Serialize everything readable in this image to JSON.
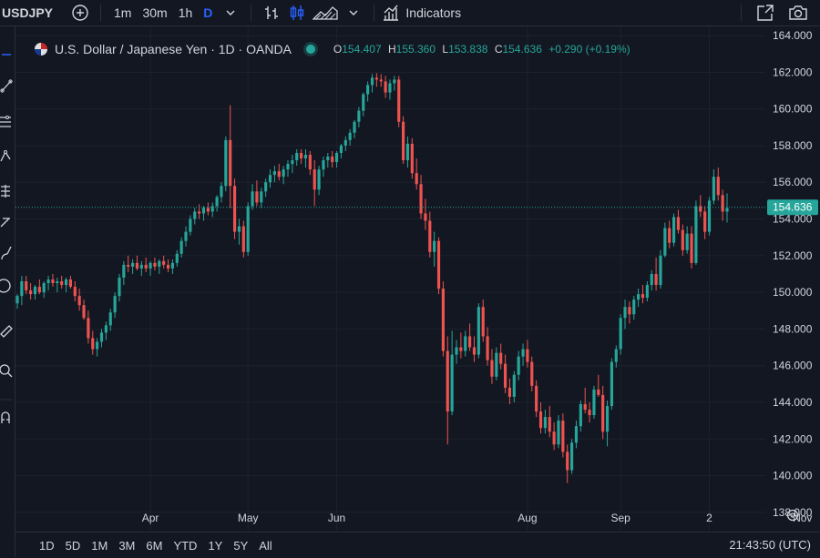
{
  "toolbar": {
    "symbol": "USDJPY",
    "intervals": [
      "1m",
      "30m",
      "1h",
      "D"
    ],
    "indicators_label": "Indicators"
  },
  "legend": {
    "title": "U.S. Dollar / Japanese Yen · 1D · OANDA",
    "open_label": "O",
    "open": "154.407",
    "high_label": "H",
    "high": "155.360",
    "low_label": "L",
    "low": "153.838",
    "close_label": "C",
    "close": "154.636",
    "change": "+0.290 (+0.19%)"
  },
  "ranges": [
    "1D",
    "5D",
    "1M",
    "3M",
    "6M",
    "YTD",
    "1Y",
    "5Y",
    "All"
  ],
  "clock": "21:43:50 (UTC)",
  "colors": {
    "background": "#131722",
    "up": "#26a69a",
    "down": "#ef5350",
    "grid": "#1e222d",
    "text": "#d1d4dc"
  },
  "icons": {
    "toolbar": [
      "add-symbol-icon",
      "chevron-down-icon",
      "bar-chart-icon",
      "candles-icon",
      "area-chart-icon",
      "indicators-icon",
      "fullscreen-icon",
      "camera-icon"
    ],
    "leftbar": [
      "crosshair-icon",
      "trendline-icon",
      "fib-icon",
      "pattern-icon",
      "forecast-icon",
      "projection-icon",
      "brush-icon",
      "text-icon",
      "emoji-icon",
      "ruler-icon",
      "zoom-icon",
      "magnet-icon"
    ]
  },
  "chart_data": {
    "type": "candlestick",
    "title": "U.S. Dollar / Japanese Yen · 1D · OANDA",
    "y_ticks": [
      "164.000",
      "162.000",
      "160.000",
      "158.000",
      "156.000",
      "154.000",
      "152.000",
      "150.000",
      "148.000",
      "146.000",
      "144.000",
      "142.000",
      "140.000",
      "138.000"
    ],
    "ylim": [
      137,
      164.5
    ],
    "x_ticks": [
      "Apr",
      "May",
      "Jun",
      "Aug",
      "Sep",
      "2",
      "Nov"
    ],
    "current_price": "154.636",
    "grid": true,
    "series": [
      {
        "name": "USDJPY",
        "ohlc": [
          [
            149.4,
            149.9,
            149.1,
            149.8
          ],
          [
            149.8,
            150.9,
            149.3,
            150.6
          ],
          [
            150.6,
            150.9,
            149.9,
            150.1
          ],
          [
            150.1,
            150.5,
            149.6,
            149.9
          ],
          [
            149.9,
            150.4,
            149.6,
            150.3
          ],
          [
            150.3,
            150.7,
            149.9,
            150.0
          ],
          [
            150.0,
            150.6,
            149.7,
            150.5
          ],
          [
            150.5,
            150.9,
            150.1,
            150.7
          ],
          [
            150.7,
            151.0,
            150.3,
            150.5
          ],
          [
            150.5,
            150.8,
            150.0,
            150.6
          ],
          [
            150.6,
            150.9,
            150.2,
            150.4
          ],
          [
            150.4,
            150.8,
            150.0,
            150.7
          ],
          [
            150.7,
            150.9,
            150.2,
            150.3
          ],
          [
            150.3,
            150.6,
            149.5,
            149.8
          ],
          [
            149.8,
            150.2,
            149.0,
            149.3
          ],
          [
            149.3,
            149.6,
            148.5,
            148.6
          ],
          [
            148.6,
            149.0,
            147.2,
            147.5
          ],
          [
            147.5,
            147.9,
            146.6,
            146.9
          ],
          [
            146.9,
            147.5,
            146.5,
            147.3
          ],
          [
            147.3,
            148.0,
            147.0,
            147.8
          ],
          [
            147.8,
            148.4,
            147.4,
            148.2
          ],
          [
            148.2,
            149.1,
            147.9,
            148.9
          ],
          [
            148.9,
            150.0,
            148.6,
            149.8
          ],
          [
            149.8,
            151.0,
            149.5,
            150.8
          ],
          [
            150.8,
            151.7,
            150.4,
            151.5
          ],
          [
            151.5,
            152.0,
            151.1,
            151.4
          ],
          [
            151.4,
            151.8,
            151.0,
            151.6
          ],
          [
            151.6,
            152.0,
            151.2,
            151.3
          ],
          [
            151.3,
            151.7,
            150.9,
            151.5
          ],
          [
            151.5,
            151.9,
            151.1,
            151.3
          ],
          [
            151.3,
            151.7,
            150.9,
            151.6
          ],
          [
            151.6,
            151.9,
            151.2,
            151.4
          ],
          [
            151.4,
            151.8,
            151.0,
            151.7
          ],
          [
            151.7,
            152.0,
            151.3,
            151.5
          ],
          [
            151.5,
            151.8,
            151.1,
            151.3
          ],
          [
            151.3,
            151.8,
            151.0,
            151.6
          ],
          [
            151.6,
            152.3,
            151.4,
            152.1
          ],
          [
            152.1,
            153.0,
            151.9,
            152.8
          ],
          [
            152.8,
            153.6,
            152.5,
            153.3
          ],
          [
            153.3,
            154.2,
            153.1,
            154.0
          ],
          [
            154.0,
            154.6,
            153.7,
            154.4
          ],
          [
            154.4,
            154.8,
            154.0,
            154.3
          ],
          [
            154.3,
            154.7,
            153.9,
            154.6
          ],
          [
            154.6,
            154.9,
            154.2,
            154.4
          ],
          [
            154.4,
            154.9,
            154.1,
            154.7
          ],
          [
            154.7,
            155.3,
            154.4,
            155.2
          ],
          [
            155.2,
            156.0,
            154.9,
            155.8
          ],
          [
            155.8,
            158.5,
            155.5,
            158.3
          ],
          [
            158.3,
            160.2,
            154.6,
            155.8
          ],
          [
            155.8,
            156.2,
            152.9,
            153.3
          ],
          [
            153.3,
            154.0,
            152.6,
            153.6
          ],
          [
            153.6,
            153.9,
            151.9,
            152.2
          ],
          [
            152.2,
            154.9,
            152.0,
            154.7
          ],
          [
            154.7,
            155.9,
            154.5,
            155.5
          ],
          [
            155.5,
            156.1,
            154.7,
            154.9
          ],
          [
            154.9,
            155.7,
            154.6,
            155.5
          ],
          [
            155.5,
            156.2,
            155.2,
            156.0
          ],
          [
            156.0,
            156.7,
            155.7,
            156.4
          ],
          [
            156.4,
            156.9,
            156.0,
            156.6
          ],
          [
            156.6,
            157.0,
            156.1,
            156.3
          ],
          [
            156.3,
            156.9,
            155.9,
            156.7
          ],
          [
            156.7,
            157.2,
            156.3,
            157.0
          ],
          [
            157.0,
            157.5,
            156.5,
            157.2
          ],
          [
            157.2,
            157.8,
            156.9,
            157.6
          ],
          [
            157.6,
            157.8,
            157.0,
            157.3
          ],
          [
            157.3,
            157.8,
            156.8,
            157.5
          ],
          [
            157.5,
            157.7,
            156.4,
            156.7
          ],
          [
            156.7,
            157.2,
            154.7,
            155.6
          ],
          [
            155.6,
            156.9,
            155.3,
            156.7
          ],
          [
            156.7,
            157.4,
            156.3,
            157.2
          ],
          [
            157.2,
            157.6,
            156.8,
            157.4
          ],
          [
            157.4,
            157.7,
            156.8,
            157.1
          ],
          [
            157.1,
            157.7,
            156.8,
            157.6
          ],
          [
            157.6,
            158.1,
            157.3,
            158.0
          ],
          [
            158.0,
            158.5,
            157.7,
            158.3
          ],
          [
            158.3,
            158.9,
            158.0,
            158.7
          ],
          [
            158.7,
            159.4,
            158.4,
            159.3
          ],
          [
            159.3,
            160.1,
            159.0,
            159.9
          ],
          [
            159.9,
            160.9,
            159.6,
            160.8
          ],
          [
            160.8,
            161.5,
            160.4,
            161.3
          ],
          [
            161.3,
            161.9,
            160.9,
            161.7
          ],
          [
            161.7,
            161.95,
            161.2,
            161.6
          ],
          [
            161.6,
            161.9,
            161.2,
            161.5
          ],
          [
            161.5,
            161.8,
            160.6,
            160.9
          ],
          [
            160.9,
            161.6,
            160.5,
            161.4
          ],
          [
            161.4,
            161.8,
            161.0,
            161.6
          ],
          [
            161.6,
            161.8,
            159.0,
            159.3
          ],
          [
            159.3,
            159.6,
            157.0,
            157.2
          ],
          [
            157.2,
            158.5,
            156.8,
            158.1
          ],
          [
            158.1,
            158.4,
            156.2,
            156.5
          ],
          [
            156.5,
            157.3,
            155.6,
            155.9
          ],
          [
            155.9,
            156.4,
            154.0,
            154.3
          ],
          [
            154.3,
            155.1,
            153.4,
            153.9
          ],
          [
            153.9,
            154.4,
            151.9,
            152.2
          ],
          [
            152.2,
            153.3,
            151.4,
            152.8
          ],
          [
            152.8,
            153.0,
            149.9,
            150.2
          ],
          [
            150.2,
            150.6,
            146.5,
            146.8
          ],
          [
            146.8,
            147.6,
            141.7,
            143.5
          ],
          [
            143.5,
            147.9,
            143.3,
            146.6
          ],
          [
            146.6,
            147.4,
            146.1,
            147.0
          ],
          [
            147.0,
            147.8,
            146.4,
            146.8
          ],
          [
            146.8,
            147.9,
            146.5,
            147.6
          ],
          [
            147.6,
            148.3,
            146.8,
            147.0
          ],
          [
            147.0,
            147.6,
            146.2,
            146.6
          ],
          [
            146.6,
            149.4,
            146.4,
            149.2
          ],
          [
            149.2,
            149.6,
            147.3,
            147.6
          ],
          [
            147.6,
            148.1,
            146.0,
            146.3
          ],
          [
            146.3,
            146.9,
            145.0,
            145.4
          ],
          [
            145.4,
            147.0,
            145.2,
            146.7
          ],
          [
            146.7,
            147.2,
            145.8,
            146.1
          ],
          [
            146.1,
            146.6,
            144.5,
            144.8
          ],
          [
            144.8,
            145.3,
            143.9,
            144.3
          ],
          [
            144.3,
            145.7,
            144.0,
            145.5
          ],
          [
            145.5,
            146.8,
            145.2,
            146.5
          ],
          [
            146.5,
            147.2,
            146.0,
            146.9
          ],
          [
            146.9,
            147.4,
            145.9,
            146.2
          ],
          [
            146.2,
            146.5,
            144.6,
            144.9
          ],
          [
            144.9,
            145.2,
            143.2,
            143.5
          ],
          [
            143.5,
            144.0,
            142.3,
            142.6
          ],
          [
            142.6,
            143.6,
            142.3,
            143.2
          ],
          [
            143.2,
            143.8,
            142.1,
            142.4
          ],
          [
            142.4,
            142.9,
            141.4,
            141.7
          ],
          [
            141.7,
            143.3,
            141.5,
            143.0
          ],
          [
            143.0,
            143.4,
            141.0,
            141.3
          ],
          [
            141.3,
            141.7,
            139.6,
            140.3
          ],
          [
            140.3,
            142.0,
            140.1,
            141.8
          ],
          [
            141.8,
            143.0,
            141.5,
            142.7
          ],
          [
            142.7,
            144.1,
            142.4,
            143.9
          ],
          [
            143.9,
            144.8,
            143.4,
            143.6
          ],
          [
            143.6,
            144.0,
            142.9,
            143.3
          ],
          [
            143.3,
            144.9,
            143.1,
            144.7
          ],
          [
            144.7,
            145.5,
            144.3,
            144.4
          ],
          [
            144.4,
            144.9,
            142.0,
            142.4
          ],
          [
            142.4,
            144.1,
            141.6,
            143.8
          ],
          [
            143.8,
            146.4,
            143.6,
            146.2
          ],
          [
            146.2,
            147.1,
            145.9,
            146.9
          ],
          [
            146.9,
            148.8,
            146.6,
            148.6
          ],
          [
            148.6,
            149.6,
            148.0,
            149.2
          ],
          [
            149.2,
            149.5,
            148.3,
            148.8
          ],
          [
            148.8,
            149.8,
            148.5,
            149.6
          ],
          [
            149.6,
            150.2,
            149.2,
            149.9
          ],
          [
            149.9,
            150.4,
            149.4,
            149.7
          ],
          [
            149.7,
            150.6,
            149.5,
            150.4
          ],
          [
            150.4,
            151.2,
            150.1,
            151.0
          ],
          [
            151.0,
            151.9,
            150.1,
            150.4
          ],
          [
            150.4,
            152.3,
            150.2,
            152.0
          ],
          [
            152.0,
            153.8,
            151.9,
            153.5
          ],
          [
            153.5,
            153.9,
            152.4,
            152.7
          ],
          [
            152.7,
            154.3,
            152.5,
            154.1
          ],
          [
            154.1,
            154.5,
            153.2,
            153.4
          ],
          [
            153.4,
            153.7,
            152.0,
            152.3
          ],
          [
            152.3,
            153.6,
            152.1,
            153.2
          ],
          [
            153.2,
            153.6,
            151.3,
            151.6
          ],
          [
            151.6,
            155.0,
            151.5,
            154.7
          ],
          [
            154.7,
            155.3,
            154.1,
            154.4
          ],
          [
            154.4,
            154.7,
            152.9,
            153.3
          ],
          [
            153.3,
            155.2,
            153.1,
            155.0
          ],
          [
            155.0,
            156.7,
            154.8,
            156.3
          ],
          [
            156.3,
            156.8,
            155.0,
            155.3
          ],
          [
            155.3,
            155.6,
            153.9,
            154.4
          ],
          [
            154.4,
            155.4,
            153.8,
            154.6
          ]
        ]
      }
    ]
  }
}
